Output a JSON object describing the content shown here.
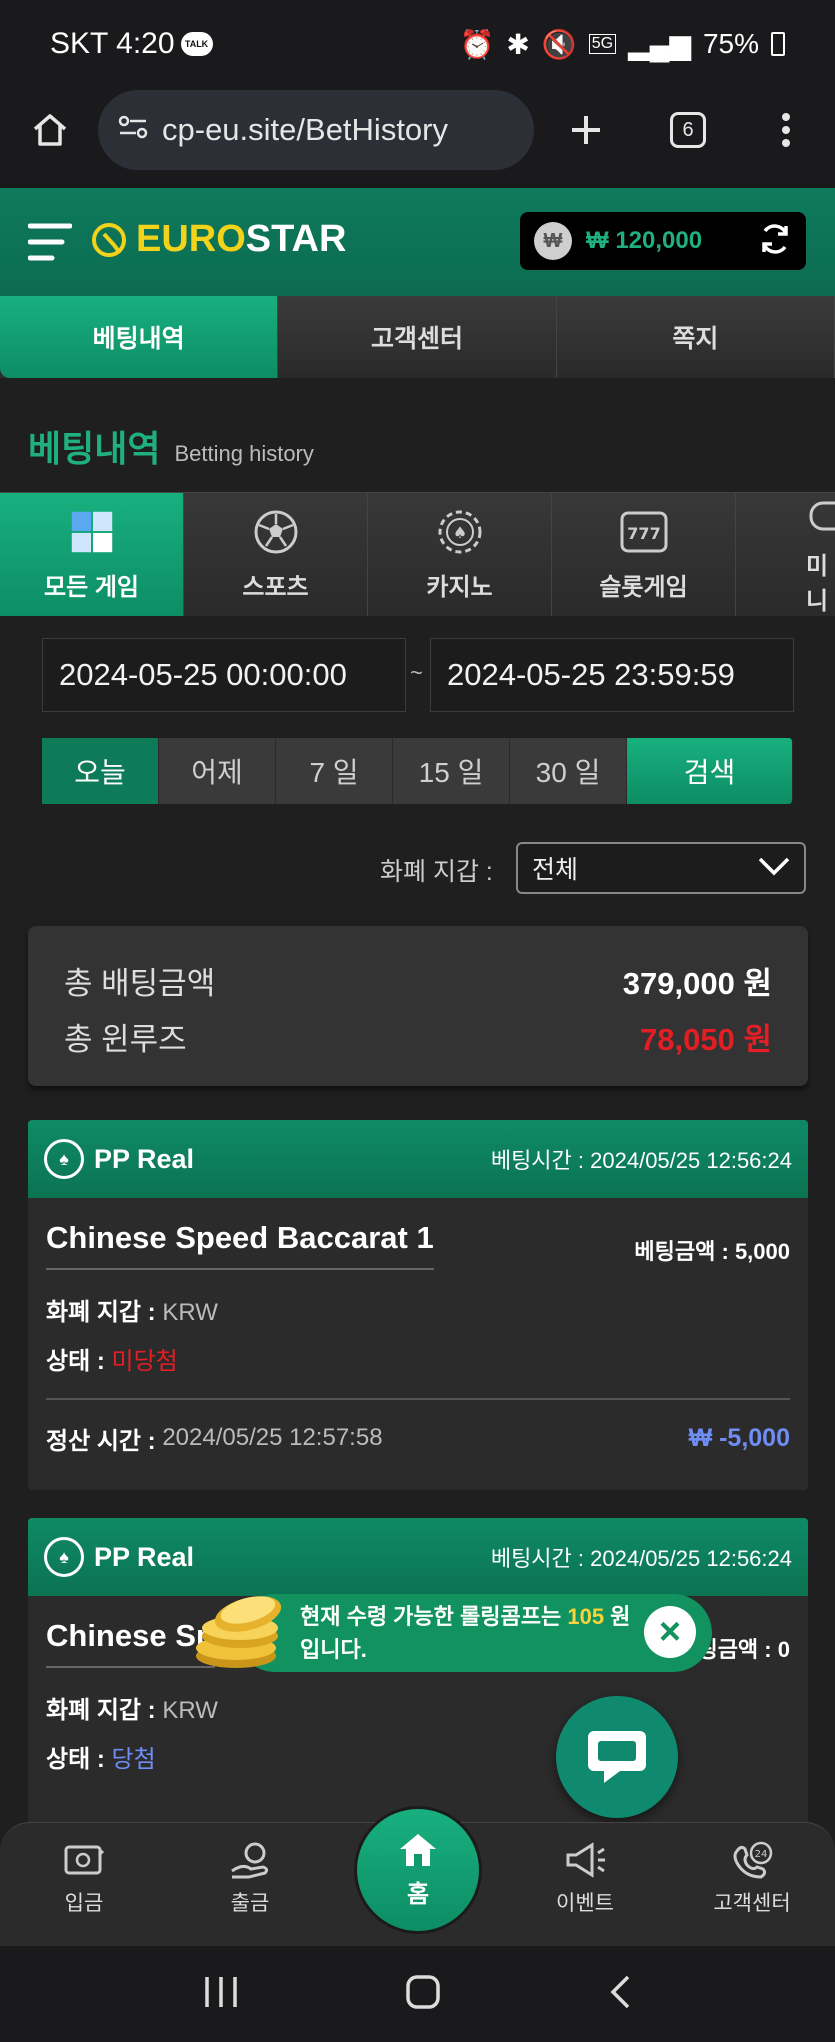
{
  "status_bar": {
    "carrier_time": "SKT 4:20",
    "talk_badge": "TALK",
    "network": "5G",
    "battery": "75%"
  },
  "browser": {
    "url": "cp-eu.site/BetHistory",
    "tab_count": "6"
  },
  "site": {
    "logo_euro": "EURO",
    "logo_star": "STAR",
    "balance": "₩ 120,000"
  },
  "top_tabs": [
    {
      "label": "베팅내역",
      "active": true
    },
    {
      "label": "고객센터",
      "active": false
    },
    {
      "label": "쪽지",
      "active": false
    }
  ],
  "section": {
    "title_ko": "베팅내역",
    "title_en": "Betting history"
  },
  "game_categories": [
    {
      "label": "모든 게임",
      "icon": "cube-icon",
      "active": true
    },
    {
      "label": "스포츠",
      "icon": "soccer-ball-icon",
      "active": false
    },
    {
      "label": "카지노",
      "icon": "casino-chip-icon",
      "active": false
    },
    {
      "label": "슬롯게임",
      "icon": "slot-machine-icon",
      "active": false
    },
    {
      "label": "미니",
      "icon": "gamepad-icon",
      "active": false
    }
  ],
  "filters": {
    "date_from": "2024-05-25 00:00:00",
    "date_sep": "~",
    "date_to": "2024-05-25 23:59:59",
    "quick": [
      "오늘",
      "어제",
      "7 일",
      "15 일",
      "30 일"
    ],
    "search_label": "검색",
    "wallet_label": "화폐 지갑 :",
    "wallet_value": "전체"
  },
  "summary": {
    "total_bet_label": "총 배팅금액",
    "total_bet_value": "379,000 원",
    "total_winloss_label": "총 윈루즈",
    "total_winloss_value": "78,050 원"
  },
  "bets": [
    {
      "provider": "PP Real",
      "bet_time_label": "베팅시간 :",
      "bet_time": "2024/05/25 12:56:24",
      "game": "Chinese Speed Baccarat 1",
      "amount_label": "베팅금액 :",
      "amount": "5,000",
      "wallet_label": "화폐 지갑 :",
      "wallet": "KRW",
      "status_label": "상태 :",
      "status": "미당첨",
      "settle_label": "정산 시간 :",
      "settle_time": "2024/05/25 12:57:58",
      "settle_amount": "₩ -5,000"
    },
    {
      "provider": "PP Real",
      "bet_time_label": "베팅시간 :",
      "bet_time": "2024/05/25 12:56:24",
      "game": "Chinese Sp",
      "amount_label": "팅금액 :",
      "amount": "0",
      "wallet_label": "화폐 지갑 :",
      "wallet": "KRW",
      "status_label": "상태 :",
      "status": "당첨"
    }
  ],
  "toast": {
    "text_before": "현재 수령 가능한 롤링콤프는 ",
    "highlight": "105",
    "text_after": " 원 입니다."
  },
  "bottom_nav": [
    {
      "label": "입금",
      "icon": "deposit-icon"
    },
    {
      "label": "출금",
      "icon": "withdraw-icon"
    },
    {
      "label": "홈",
      "icon": "home-icon"
    },
    {
      "label": "이벤트",
      "icon": "megaphone-icon"
    },
    {
      "label": "고객센터",
      "icon": "support-24-icon"
    }
  ],
  "colors": {
    "brand_green": "#0f8a65",
    "accent_yellow": "#f3d21b",
    "loss_red": "#e31e24",
    "win_blue": "#6f8df5"
  }
}
